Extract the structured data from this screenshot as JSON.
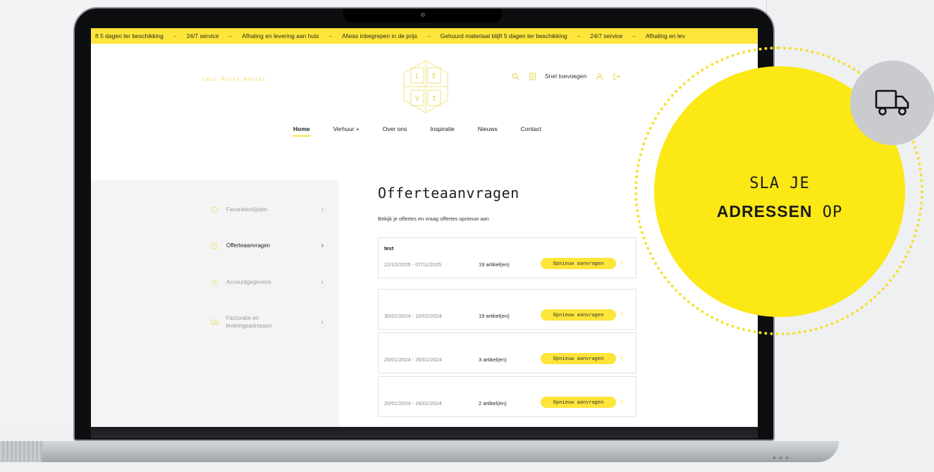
{
  "marquee": {
    "items": [
      "ft 5 dagen ter beschikking",
      "24/7 service",
      "Afhaling en levering aan huis",
      "Afwas inbegrepen in de prijs",
      "Gehuurd materiaal blijft 5 dagen ter beschikking",
      "24/7 service",
      "Afhaling en lev"
    ],
    "separator": "–"
  },
  "header": {
    "brand_name": "Levi Party Rental",
    "logo_letters": [
      "L",
      "E",
      "V",
      "I"
    ],
    "quick_add_label": "Snel toevoegen"
  },
  "nav": {
    "items": [
      {
        "label": "Home",
        "active": true
      },
      {
        "label": "Verhuur +",
        "active": false
      },
      {
        "label": "Over ons",
        "active": false
      },
      {
        "label": "Inspiratie",
        "active": false
      },
      {
        "label": "Nieuws",
        "active": false
      },
      {
        "label": "Contact",
        "active": false
      }
    ]
  },
  "sidebar": {
    "items": [
      {
        "label": "Favorietenlijsten",
        "icon": "heart-icon",
        "active": false
      },
      {
        "label": "Offerteaanvragen",
        "icon": "document-icon",
        "active": true
      },
      {
        "label": "Accountgegevens",
        "icon": "user-icon",
        "active": false
      },
      {
        "label": "Facturatie en leveringsadressen",
        "icon": "truck-icon",
        "active": false
      }
    ],
    "chevron": "›"
  },
  "main": {
    "title": "Offerteaanvragen",
    "subtitle": "Bekijk je offertes en vraag offertes opnieuw aan",
    "quotes": [
      {
        "name": "test",
        "dates": "22/10/2025 - 07/11/2025",
        "count": "19 artikel(en)",
        "button": "Opnieuw aanvragen"
      },
      {
        "name": "",
        "dates": "30/01/2024 - 10/02/2024",
        "count": "19 artikel(en)",
        "button": "Opnieuw aanvragen"
      },
      {
        "name": "",
        "dates": "20/01/2024 - 26/01/2024",
        "count": "3 artikel(en)",
        "button": "Opnieuw aanvragen"
      },
      {
        "name": "",
        "dates": "20/01/2024 - 26/01/2024",
        "count": "2 artikel(en)",
        "button": "Opnieuw aanvragen"
      }
    ],
    "chevron": "›"
  },
  "promo": {
    "line1": "SLA JE",
    "highlight": "ADRESSEN",
    "line2_rest": "OP",
    "icon": "truck-icon"
  },
  "colors": {
    "accent_yellow": "#fde53a",
    "promo_yellow": "#fbe815",
    "text_dark": "#1e1e1e"
  }
}
